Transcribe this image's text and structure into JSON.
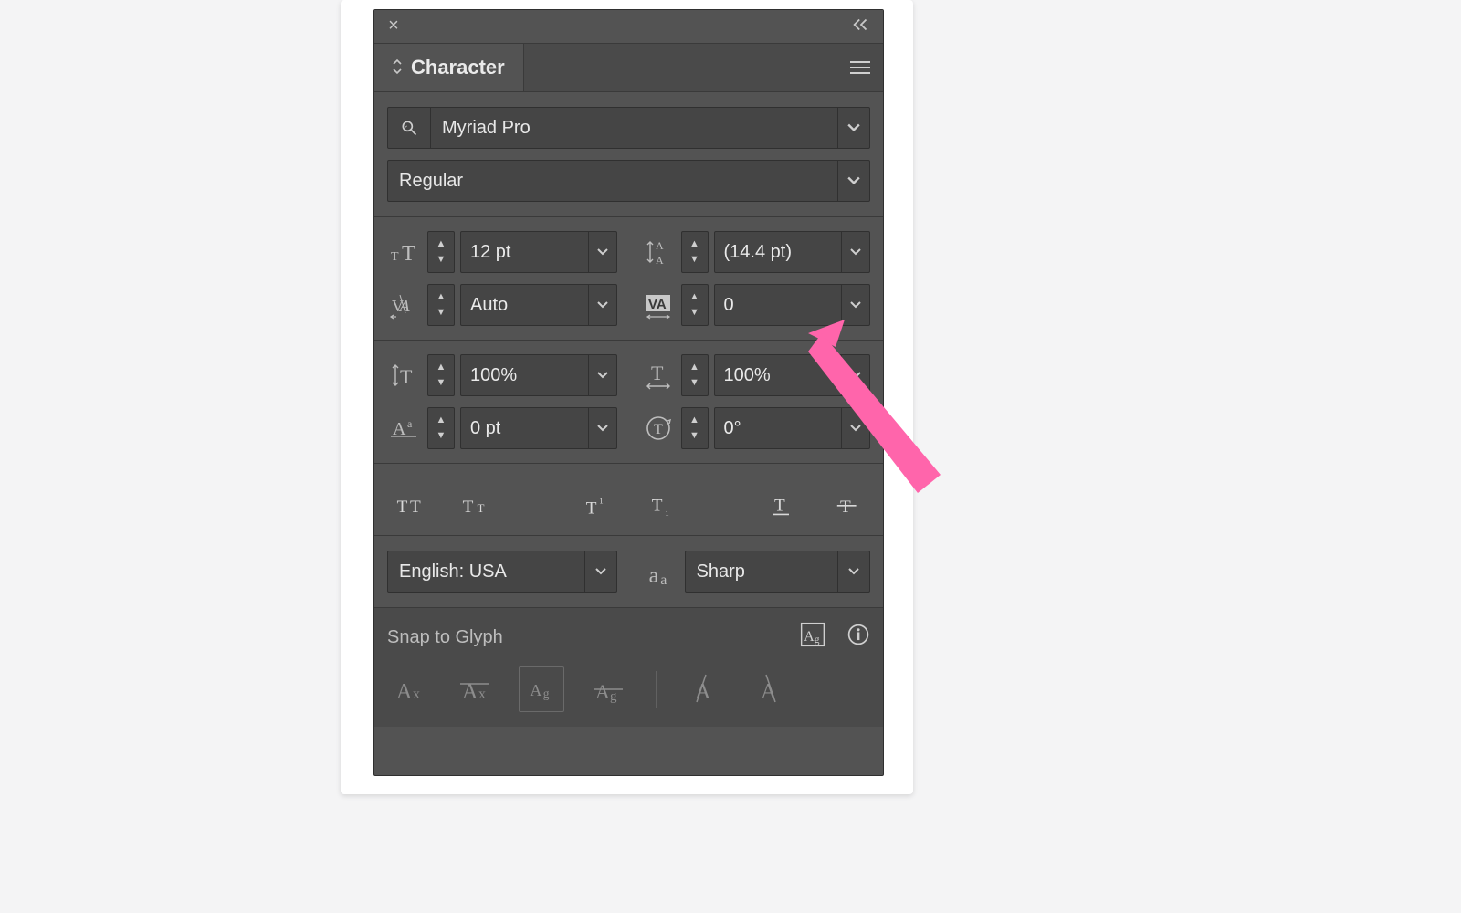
{
  "panel": {
    "title": "Character"
  },
  "font": {
    "family": "Myriad Pro",
    "style": "Regular"
  },
  "metrics": {
    "size": "12 pt",
    "leading": "(14.4 pt)",
    "kerning": "Auto",
    "tracking": "0",
    "vscale": "100%",
    "hscale": "100%",
    "baseline": "0 pt",
    "rotation": "0°"
  },
  "language": "English: USA",
  "antialias": "Sharp",
  "footer": {
    "title": "Snap to Glyph"
  },
  "annotation": {
    "arrow_color": "#ff65ab"
  }
}
